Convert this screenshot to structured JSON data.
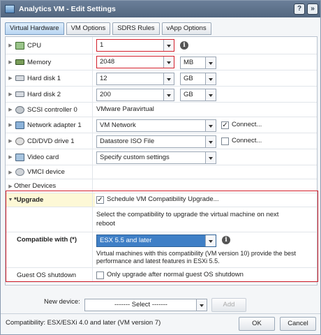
{
  "window": {
    "title": "Analytics VM - Edit Settings",
    "help_glyph": "?",
    "popout_glyph": "»"
  },
  "tabs": [
    {
      "label": "Virtual Hardware",
      "active": true
    },
    {
      "label": "VM Options",
      "active": false
    },
    {
      "label": "SDRS Rules",
      "active": false
    },
    {
      "label": "vApp Options",
      "active": false
    }
  ],
  "hardware": {
    "cpu": {
      "label": "CPU",
      "value": "1",
      "icon": "cpu-icon"
    },
    "memory": {
      "label": "Memory",
      "value": "2048",
      "unit": "MB",
      "icon": "memory-icon"
    },
    "hard_disk_1": {
      "label": "Hard disk 1",
      "value": "12",
      "unit": "GB",
      "icon": "hard-disk-icon"
    },
    "hard_disk_2": {
      "label": "Hard disk 2",
      "value": "200",
      "unit": "GB",
      "icon": "hard-disk-icon"
    },
    "scsi": {
      "label": "SCSI controller 0",
      "value": "VMware Paravirtual",
      "icon": "scsi-controller-icon"
    },
    "network": {
      "label": "Network adapter 1",
      "value": "VM Network",
      "connect_label": "Connect...",
      "connected": true,
      "icon": "network-adapter-icon"
    },
    "cd": {
      "label": "CD/DVD drive 1",
      "value": "Datastore ISO File",
      "connect_label": "Connect...",
      "connected": false,
      "icon": "cd-drive-icon"
    },
    "video": {
      "label": "Video card",
      "value": "Specify custom settings",
      "icon": "video-card-icon"
    },
    "vmci": {
      "label": "VMCI device",
      "icon": "vmci-device-icon"
    },
    "other": {
      "label": "Other Devices"
    }
  },
  "upgrade": {
    "label": "*Upgrade",
    "schedule_label": "Schedule VM Compatibility Upgrade...",
    "schedule_checked": true,
    "description": "Select the compatibility to upgrade the virtual machine on next reboot",
    "compatible_label": "Compatible with (*)",
    "compatible_value": "ESX 5.5 and later",
    "compatible_note": "Virtual machines with this compatibility (VM version 10) provide the best performance and latest features in ESXi 5.5.",
    "guest_label": "Guest OS shutdown",
    "guest_option": "Only upgrade after normal guest OS shutdown",
    "guest_checked": false
  },
  "footer": {
    "new_device_label": "New device:",
    "new_device_value": "------- Select -------",
    "add_label": "Add",
    "compatibility_status": "Compatibility: ESX/ESXi 4.0 and later (VM version 7)",
    "ok_label": "OK",
    "cancel_label": "Cancel"
  },
  "colors": {
    "highlight_red": "#d21f2b",
    "selected_blue": "#3f7fc6",
    "titlebar": "#5d7089"
  }
}
